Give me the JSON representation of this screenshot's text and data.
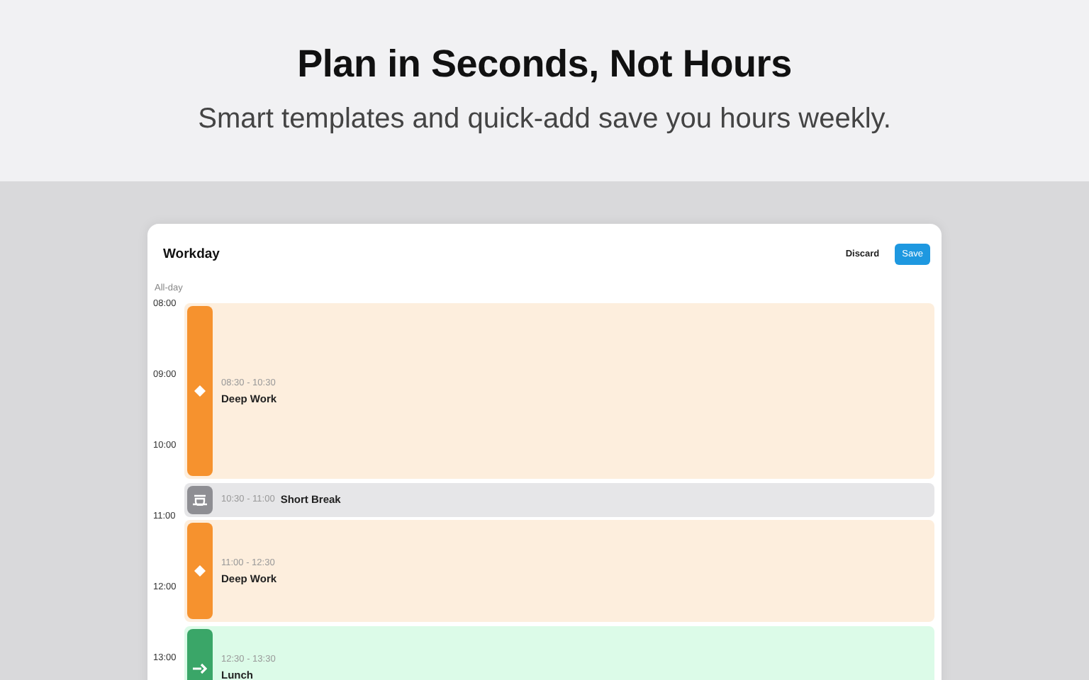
{
  "headline": {
    "title": "Plan in Seconds, Not Hours",
    "subtitle": "Smart templates and quick-add save you hours weekly."
  },
  "card": {
    "title": "Workday",
    "buttons": [
      {
        "label": "Discard",
        "kind": "plain"
      },
      {
        "label": "Save",
        "kind": "primary"
      }
    ],
    "all_day_label": "All-day",
    "hours": [
      "08:00",
      "09:00",
      "10:00",
      "11:00",
      "12:00",
      "13:00"
    ],
    "events": [
      {
        "kind": "focus",
        "color": "#f6922e",
        "time": "08:30 - 10:30",
        "title": "Deep Work"
      },
      {
        "kind": "break",
        "color": "#8e8e93",
        "time": "10:30 - 11:00",
        "title": "Short Break"
      },
      {
        "kind": "focus",
        "color": "#f6922e",
        "time": "11:00 - 12:30",
        "title": "Deep Work"
      },
      {
        "kind": "meal",
        "color": "#3aa668",
        "time": "12:30 - 13:30",
        "title": "Lunch"
      }
    ]
  }
}
